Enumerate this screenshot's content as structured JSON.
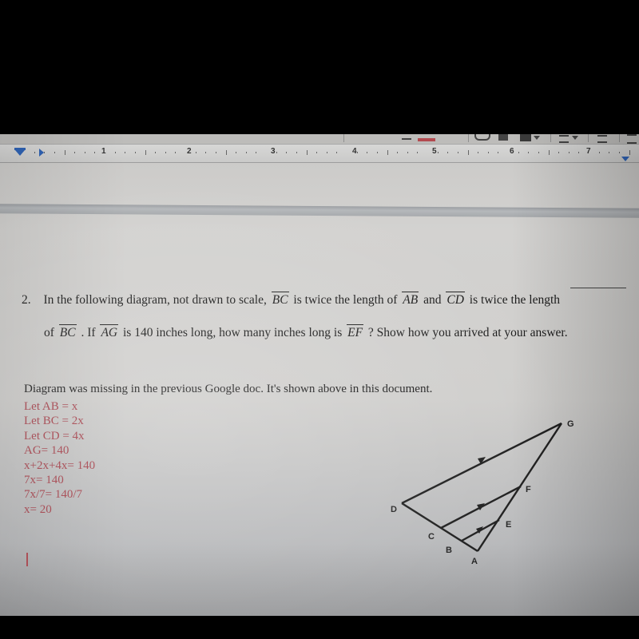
{
  "ruler": {
    "numbers": [
      "1",
      "2",
      "3",
      "4",
      "5",
      "6",
      "7"
    ]
  },
  "toolbar": {
    "icons": [
      "underline-icon",
      "text-color-icon",
      "link-icon",
      "comment-icon",
      "insert-image-icon",
      "align-icon",
      "line-spacing-icon",
      "list-icon"
    ],
    "text_color_accent": "#b34a4f"
  },
  "question": {
    "number": "2.",
    "line1": {
      "t1": "In the following diagram, not drawn to scale,",
      "seg1": "BC",
      "t2": "is twice the length of",
      "seg2": "AB",
      "t3": "and",
      "seg3": "CD",
      "t4": "is twice the length"
    },
    "line2": {
      "t1": "of",
      "seg1": "BC",
      "t2": ". If",
      "seg2": "AG",
      "t3": "is 140 inches long, how many inches long is",
      "seg3": "EF",
      "t4": "? Show how you arrived at your answer."
    }
  },
  "answer": {
    "note": "Diagram was missing in the previous Google doc. It's shown above in this document.",
    "work_color": "#a8434d",
    "work_lines": [
      "Let AB = x",
      "Let BC = 2x",
      "Let CD = 4x",
      "AG= 140",
      "x+2x+4x= 140",
      "7x= 140",
      "7x/7= 140/7",
      "x= 20"
    ]
  },
  "diagram": {
    "labels": {
      "G": "G",
      "F": "F",
      "E": "E",
      "D": "D",
      "C": "C",
      "B": "B",
      "A": "A"
    }
  }
}
